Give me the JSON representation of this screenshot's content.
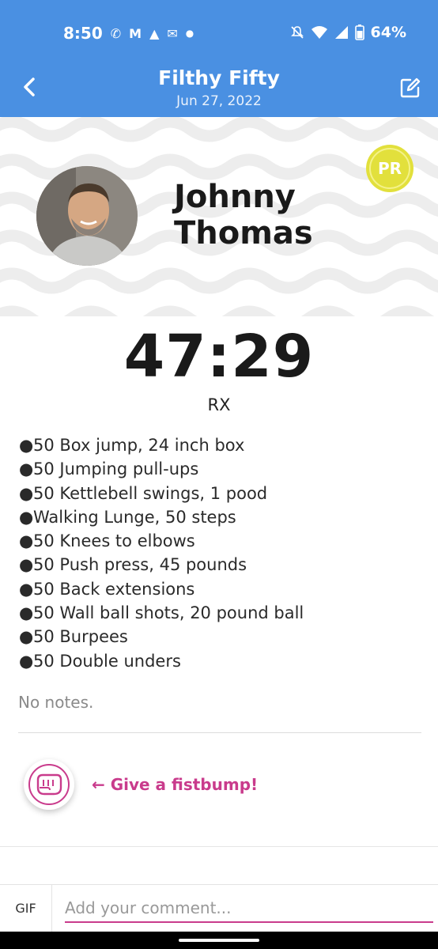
{
  "status_bar": {
    "time": "8:50",
    "notification_icons": [
      "whatsapp-icon",
      "gmail-icon",
      "strava-icon",
      "outlook-icon"
    ],
    "battery": "64%",
    "color": "#4a90e2"
  },
  "header": {
    "title": "Filthy Fifty",
    "date": "Jun 27, 2022",
    "color": "#4a90e2"
  },
  "result": {
    "athlete_name": "Johnny Thomas",
    "badge": "PR",
    "badge_color": "#e2e03c",
    "score": "47:29",
    "scale": "RX"
  },
  "workout": {
    "movements": [
      "50 Box jump, 24 inch box",
      "50 Jumping pull-ups",
      "50 Kettlebell swings, 1 pood",
      "Walking Lunge, 50 steps",
      "50 Knees to elbows",
      "50 Push press, 45 pounds",
      "50 Back extensions",
      "50 Wall ball shots, 20 pound ball",
      "50 Burpees",
      "50 Double unders"
    ],
    "notes": "No notes."
  },
  "fistbump": {
    "label": "← Give a fistbump!",
    "accent_color": "#c93b8c"
  },
  "comment": {
    "gif_label": "GIF",
    "placeholder": "Add your comment..."
  }
}
